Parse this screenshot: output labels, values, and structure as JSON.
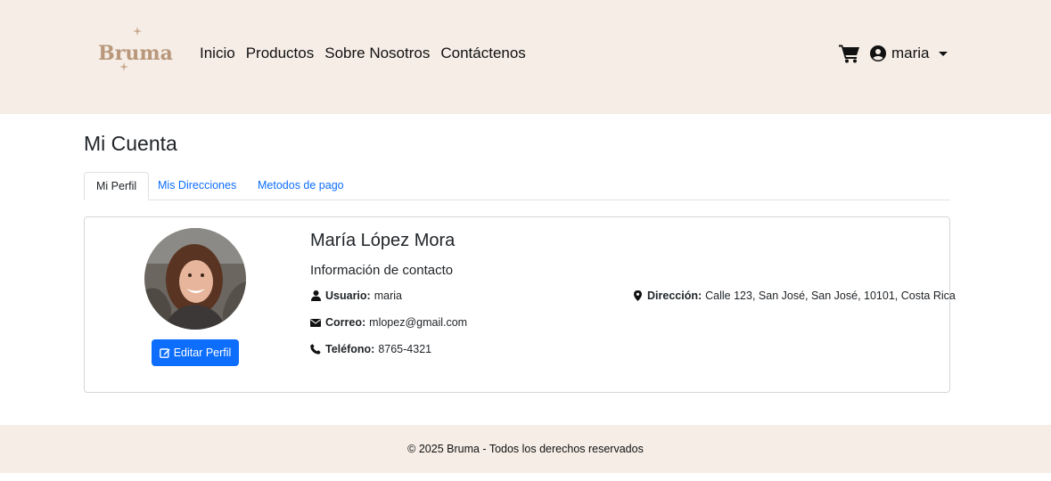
{
  "brand": {
    "logo_text": "Bruma",
    "logo_color": "#b8977a"
  },
  "nav": {
    "items": [
      "Inicio",
      "Productos",
      "Sobre Nosotros",
      "Contáctenos"
    ]
  },
  "user_menu": {
    "username": "maria"
  },
  "page": {
    "title": "Mi Cuenta",
    "tabs": [
      "Mi Perfil",
      "Mis Direcciones",
      "Metodos de pago"
    ],
    "active_tab": "Mi Perfil"
  },
  "profile": {
    "full_name": "María López Mora",
    "edit_button_label": "Editar Perfil",
    "contact_title": "Información de contacto",
    "user_label": "Usuario:",
    "user_value": "maria",
    "email_label": "Correo:",
    "email_value": "mlopez@gmail.com",
    "phone_label": "Teléfono:",
    "phone_value": "8765-4321",
    "address_label": "Dirección:",
    "address_value": "Calle 123, San José, San José, 10101, Costa Rica"
  },
  "footer": {
    "text": "© 2025 Bruma - Todos los derechos reservados"
  },
  "colors": {
    "header_bg": "#f5ede6",
    "primary": "#0d6efd",
    "link": "#0d6efd"
  },
  "icons": {
    "cart": "cart-icon",
    "user": "user-circle-icon",
    "edit": "edit-icon",
    "person": "person-icon",
    "envelope": "envelope-icon",
    "phone": "phone-icon",
    "location": "map-marker-icon"
  }
}
